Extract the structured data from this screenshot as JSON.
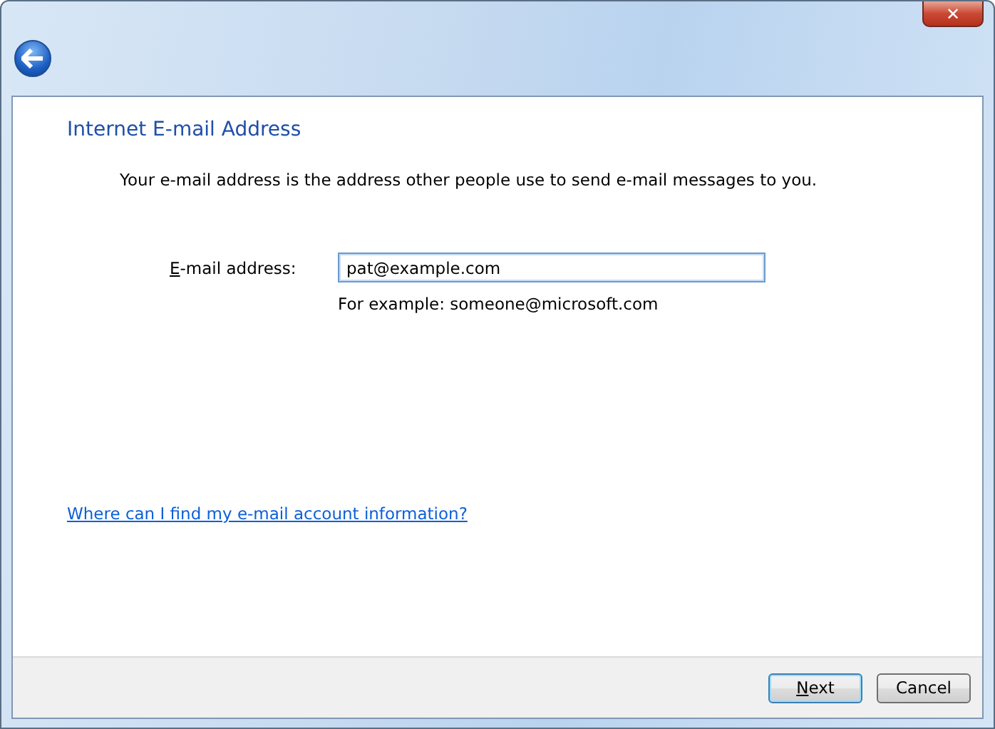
{
  "window": {
    "close_button": "✕"
  },
  "heading": "Internet E-mail Address",
  "description": "Your e-mail address is the address other people use to send e-mail messages to you.",
  "email_field": {
    "label_key": "E",
    "label_rest": "-mail address:",
    "value": "pat@example.com",
    "focused": true,
    "hint": "For example: someone@microsoft.com"
  },
  "help_link": "Where can I find my e-mail account information?",
  "buttons": [
    {
      "key": "N",
      "rest": "ext",
      "default": true
    },
    {
      "rest": "Cancel",
      "default": false
    }
  ]
}
